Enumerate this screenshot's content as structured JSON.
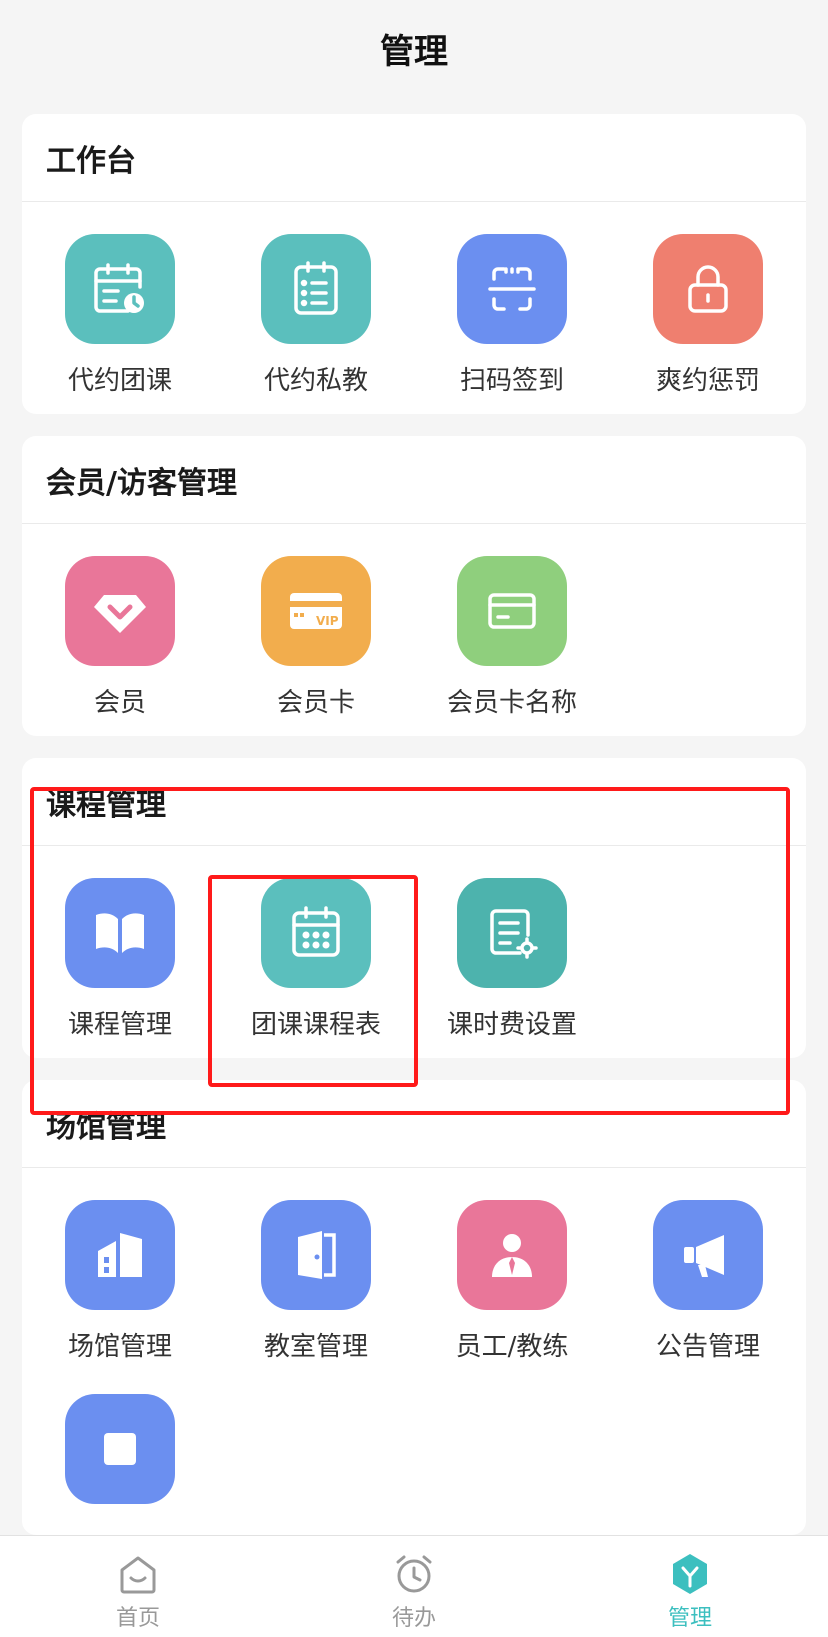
{
  "header": {
    "title": "管理"
  },
  "sections": [
    {
      "title": "工作台",
      "items": [
        {
          "label": "代约团课",
          "icon": "calendar-clock-icon",
          "color": "#5bbfbd"
        },
        {
          "label": "代约私教",
          "icon": "clipboard-list-icon",
          "color": "#5bbfbd"
        },
        {
          "label": "扫码签到",
          "icon": "scan-icon",
          "color": "#6b8ff0"
        },
        {
          "label": "爽约惩罚",
          "icon": "lock-icon",
          "color": "#ef7f6f"
        }
      ]
    },
    {
      "title": "会员/访客管理",
      "items": [
        {
          "label": "会员",
          "icon": "diamond-icon",
          "color": "#e97699"
        },
        {
          "label": "会员卡",
          "icon": "vip-card-icon",
          "color": "#f2ad4d",
          "badge": "VIP"
        },
        {
          "label": "会员卡名称",
          "icon": "card-icon",
          "color": "#8fcf7d"
        }
      ]
    },
    {
      "title": "课程管理",
      "items": [
        {
          "label": "课程管理",
          "icon": "book-icon",
          "color": "#6b8ff0"
        },
        {
          "label": "团课课程表",
          "icon": "calendar-icon",
          "color": "#5bbfbd"
        },
        {
          "label": "课时费设置",
          "icon": "doc-settings-icon",
          "color": "#4db3ad"
        }
      ]
    },
    {
      "title": "场馆管理",
      "items": [
        {
          "label": "场馆管理",
          "icon": "building-icon",
          "color": "#6b8ff0"
        },
        {
          "label": "教室管理",
          "icon": "door-icon",
          "color": "#6b8ff0"
        },
        {
          "label": "员工/教练",
          "icon": "staff-icon",
          "color": "#e97699"
        },
        {
          "label": "公告管理",
          "icon": "megaphone-icon",
          "color": "#6b8ff0"
        },
        {
          "label": "",
          "icon": "square-icon",
          "color": "#6b8ff0"
        }
      ]
    }
  ],
  "tabbar": [
    {
      "label": "首页",
      "icon": "home-icon",
      "active": false
    },
    {
      "label": "待办",
      "icon": "alarm-clock-icon",
      "active": false
    },
    {
      "label": "管理",
      "icon": "manage-hexagon-icon",
      "active": true
    }
  ],
  "colors": {
    "accent": "#3cbfbf",
    "highlight": "#ff1a1a"
  }
}
